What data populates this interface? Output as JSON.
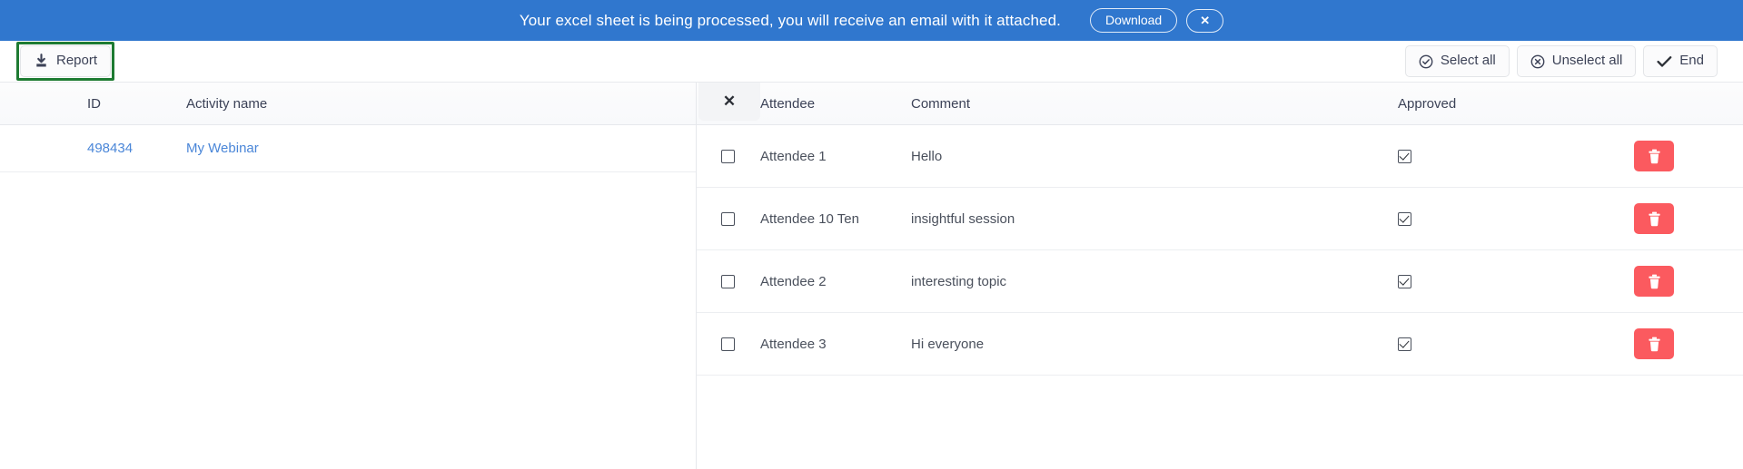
{
  "banner": {
    "message": "Your excel sheet is being processed, you will receive an email with it attached.",
    "download_label": "Download",
    "close_label": "✕",
    "background_color": "#3077ce"
  },
  "toolbar": {
    "report_label": "Report",
    "report_icon": "download-icon",
    "highlight_color": "#1e7b32",
    "select_all_label": "Select all",
    "unselect_all_label": "Unselect all",
    "end_label": "End"
  },
  "left_table": {
    "columns": [
      "ID",
      "Activity name"
    ],
    "rows": [
      {
        "id": "498434",
        "activity_name": "My Webinar"
      }
    ]
  },
  "right_panel": {
    "close_label": "✕",
    "columns": [
      "",
      "Attendee",
      "Comment",
      "Approved",
      ""
    ],
    "delete_icon": "trash-icon",
    "delete_color": "#fb5a5f",
    "rows": [
      {
        "selected": false,
        "attendee": "Attendee 1",
        "comment": "Hello",
        "approved": true
      },
      {
        "selected": false,
        "attendee": "Attendee 10 Ten",
        "comment": "insightful session",
        "approved": true
      },
      {
        "selected": false,
        "attendee": "Attendee 2",
        "comment": "interesting topic",
        "approved": true
      },
      {
        "selected": false,
        "attendee": "Attendee 3",
        "comment": "Hi everyone",
        "approved": true
      }
    ]
  }
}
